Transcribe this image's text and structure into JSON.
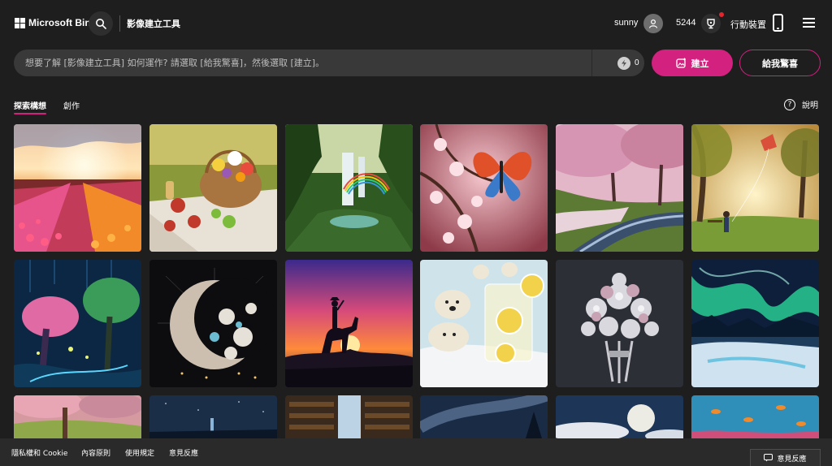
{
  "header": {
    "logo_text": "Microsoft Bing",
    "app_title": "影像建立工具",
    "user_name": "sunny",
    "points": "5244",
    "mobile_label": "行動裝置"
  },
  "prompt": {
    "placeholder": "想要了解 [影像建立工具] 如何運作? 請選取 [給我驚喜]，然後選取 [建立]。",
    "boost_count": "0",
    "create_label": "建立",
    "surprise_label": "給我驚喜"
  },
  "tabs": {
    "explore": "探索構想",
    "create": "創作",
    "help": "說明"
  },
  "gallery": {
    "items": [
      {
        "icon": "tulip-field-sunrise"
      },
      {
        "icon": "picnic-basket-flowers"
      },
      {
        "icon": "waterfall-rainbow"
      },
      {
        "icon": "butterfly-cherry-blossom"
      },
      {
        "icon": "cherry-blossom-stream"
      },
      {
        "icon": "park-kite-sunset"
      },
      {
        "icon": "fantasy-glowing-forest"
      },
      {
        "icon": "crescent-moon-flowers"
      },
      {
        "icon": "horse-rider-silhouette"
      },
      {
        "icon": "polar-bears-lemonade"
      },
      {
        "icon": "white-flower-bouquet"
      },
      {
        "icon": "aurora-landscape"
      },
      {
        "icon": "pink-blossom-garden"
      },
      {
        "icon": "night-sky-city"
      },
      {
        "icon": "library-corridor"
      },
      {
        "icon": "milky-way-forest"
      },
      {
        "icon": "full-moon-clouds"
      },
      {
        "icon": "underwater-fish"
      }
    ]
  },
  "footer": {
    "privacy": "隱私權和 Cookie",
    "content_policy": "內容原則",
    "terms": "使用規定",
    "feedback": "意見反應",
    "feedback_button": "意見反應"
  },
  "colors": {
    "background": "#1f1e1e",
    "accent": "#d2217e"
  }
}
